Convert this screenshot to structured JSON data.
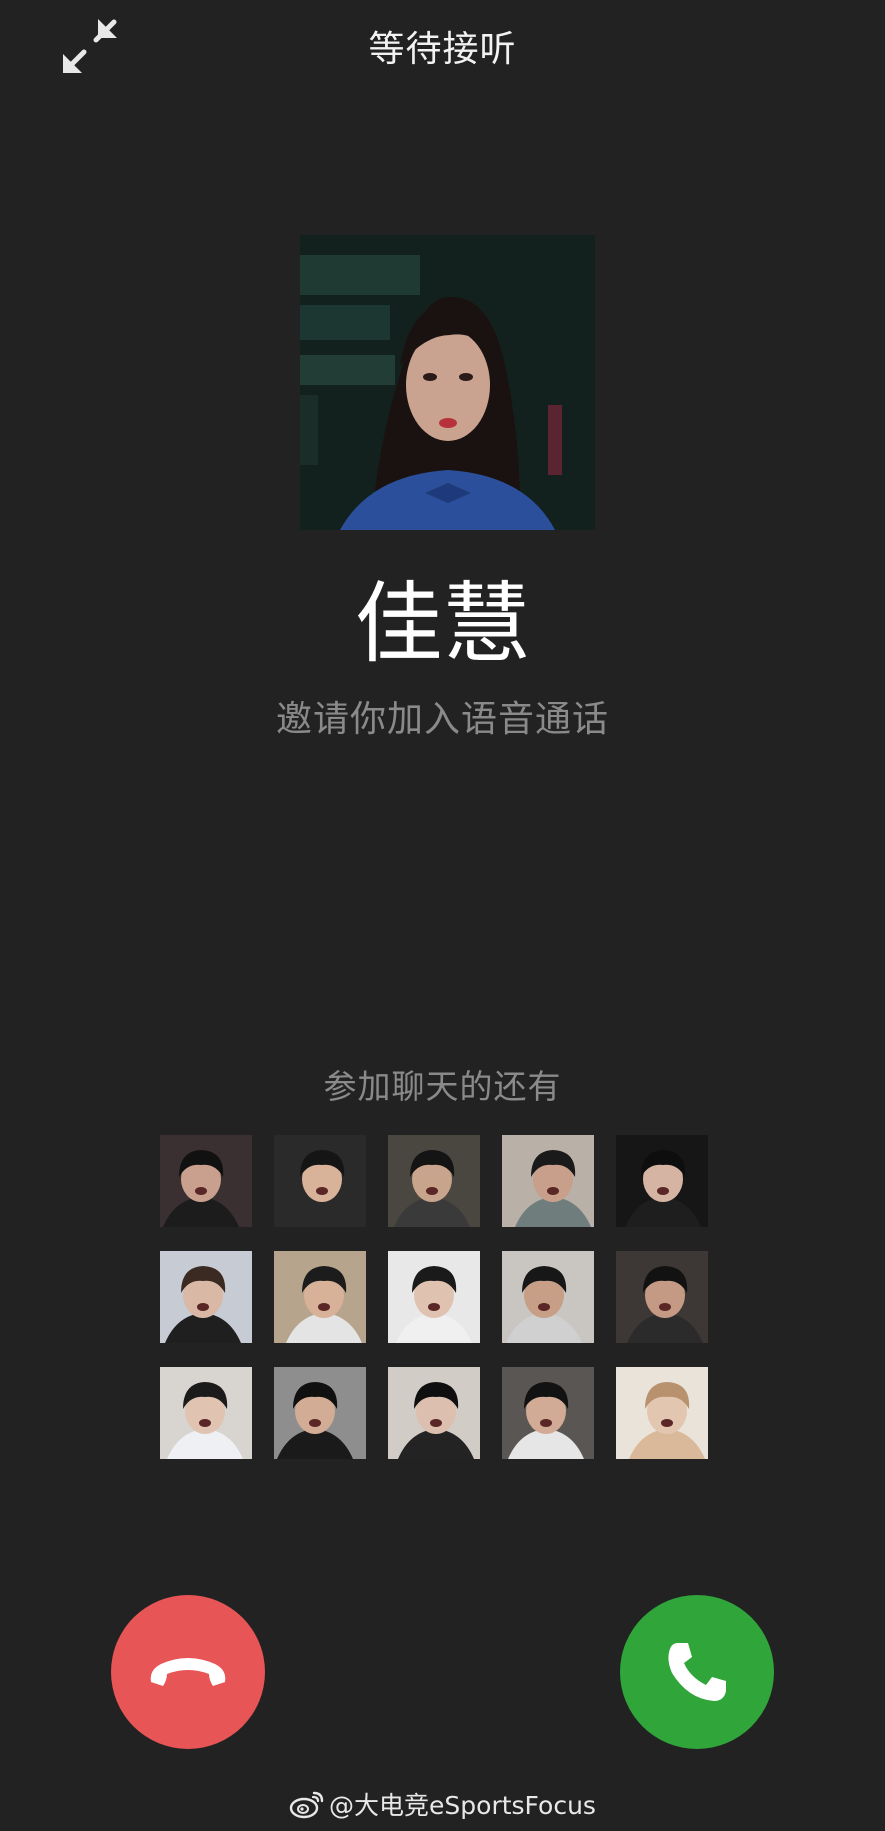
{
  "header": {
    "status": "等待接听",
    "minimize_icon": "minimize-arrows-icon"
  },
  "caller": {
    "name": "佳慧",
    "invite_text": "邀请你加入语音通话",
    "avatar_desc": "avatar"
  },
  "participants": {
    "label": "参加聊天的还有",
    "items": [
      {
        "bg": "#3a3032",
        "skin": "#c9a08e",
        "hair": "#111111",
        "shirt": "#1c1c1c"
      },
      {
        "bg": "#2a2a2a",
        "skin": "#d8b39a",
        "hair": "#151515",
        "shirt": "#2a2a2a"
      },
      {
        "bg": "#4a4640",
        "skin": "#c7a48b",
        "hair": "#141414",
        "shirt": "#3a3a3a"
      },
      {
        "bg": "#b9b0a8",
        "skin": "#c89f8a",
        "hair": "#1a1a1a",
        "shirt": "#6f7e7c"
      },
      {
        "bg": "#161616",
        "skin": "#d6b4a4",
        "hair": "#0e0e0e",
        "shirt": "#1e1e1e"
      },
      {
        "bg": "#c7ccd4",
        "skin": "#d9b9a6",
        "hair": "#3a2a22",
        "shirt": "#1f1f1f"
      },
      {
        "bg": "#b6a48c",
        "skin": "#d7b299",
        "hair": "#1c1c1c",
        "shirt": "#e4e4e4"
      },
      {
        "bg": "#e8e8e8",
        "skin": "#e0c2b0",
        "hair": "#1a1a1a",
        "shirt": "#f0f0f0"
      },
      {
        "bg": "#c9c6c2",
        "skin": "#c79e86",
        "hair": "#171717",
        "shirt": "#d0d0d0"
      },
      {
        "bg": "#3d3836",
        "skin": "#c49a84",
        "hair": "#121212",
        "shirt": "#2b2b2b"
      },
      {
        "bg": "#d8d4cf",
        "skin": "#e1c3b2",
        "hair": "#1b1b1b",
        "shirt": "#eef0f4"
      },
      {
        "bg": "#8e8e8e",
        "skin": "#d3ac95",
        "hair": "#101010",
        "shirt": "#1a1a1a"
      },
      {
        "bg": "#d2ccc6",
        "skin": "#dcbfae",
        "hair": "#0f0f0f",
        "shirt": "#232323"
      },
      {
        "bg": "#5a5654",
        "skin": "#d1ab95",
        "hair": "#121212",
        "shirt": "#e6e6e6"
      },
      {
        "bg": "#e9e3da",
        "skin": "#e3c6b0",
        "hair": "#b8926f",
        "shirt": "#d9b999"
      }
    ]
  },
  "actions": {
    "decline_icon": "hang-up-icon",
    "accept_icon": "phone-icon",
    "decline_color": "#e75556",
    "accept_color": "#2fa53a"
  },
  "watermark": {
    "text": "@大电竞eSportsFocus",
    "icon": "weibo-icon"
  }
}
